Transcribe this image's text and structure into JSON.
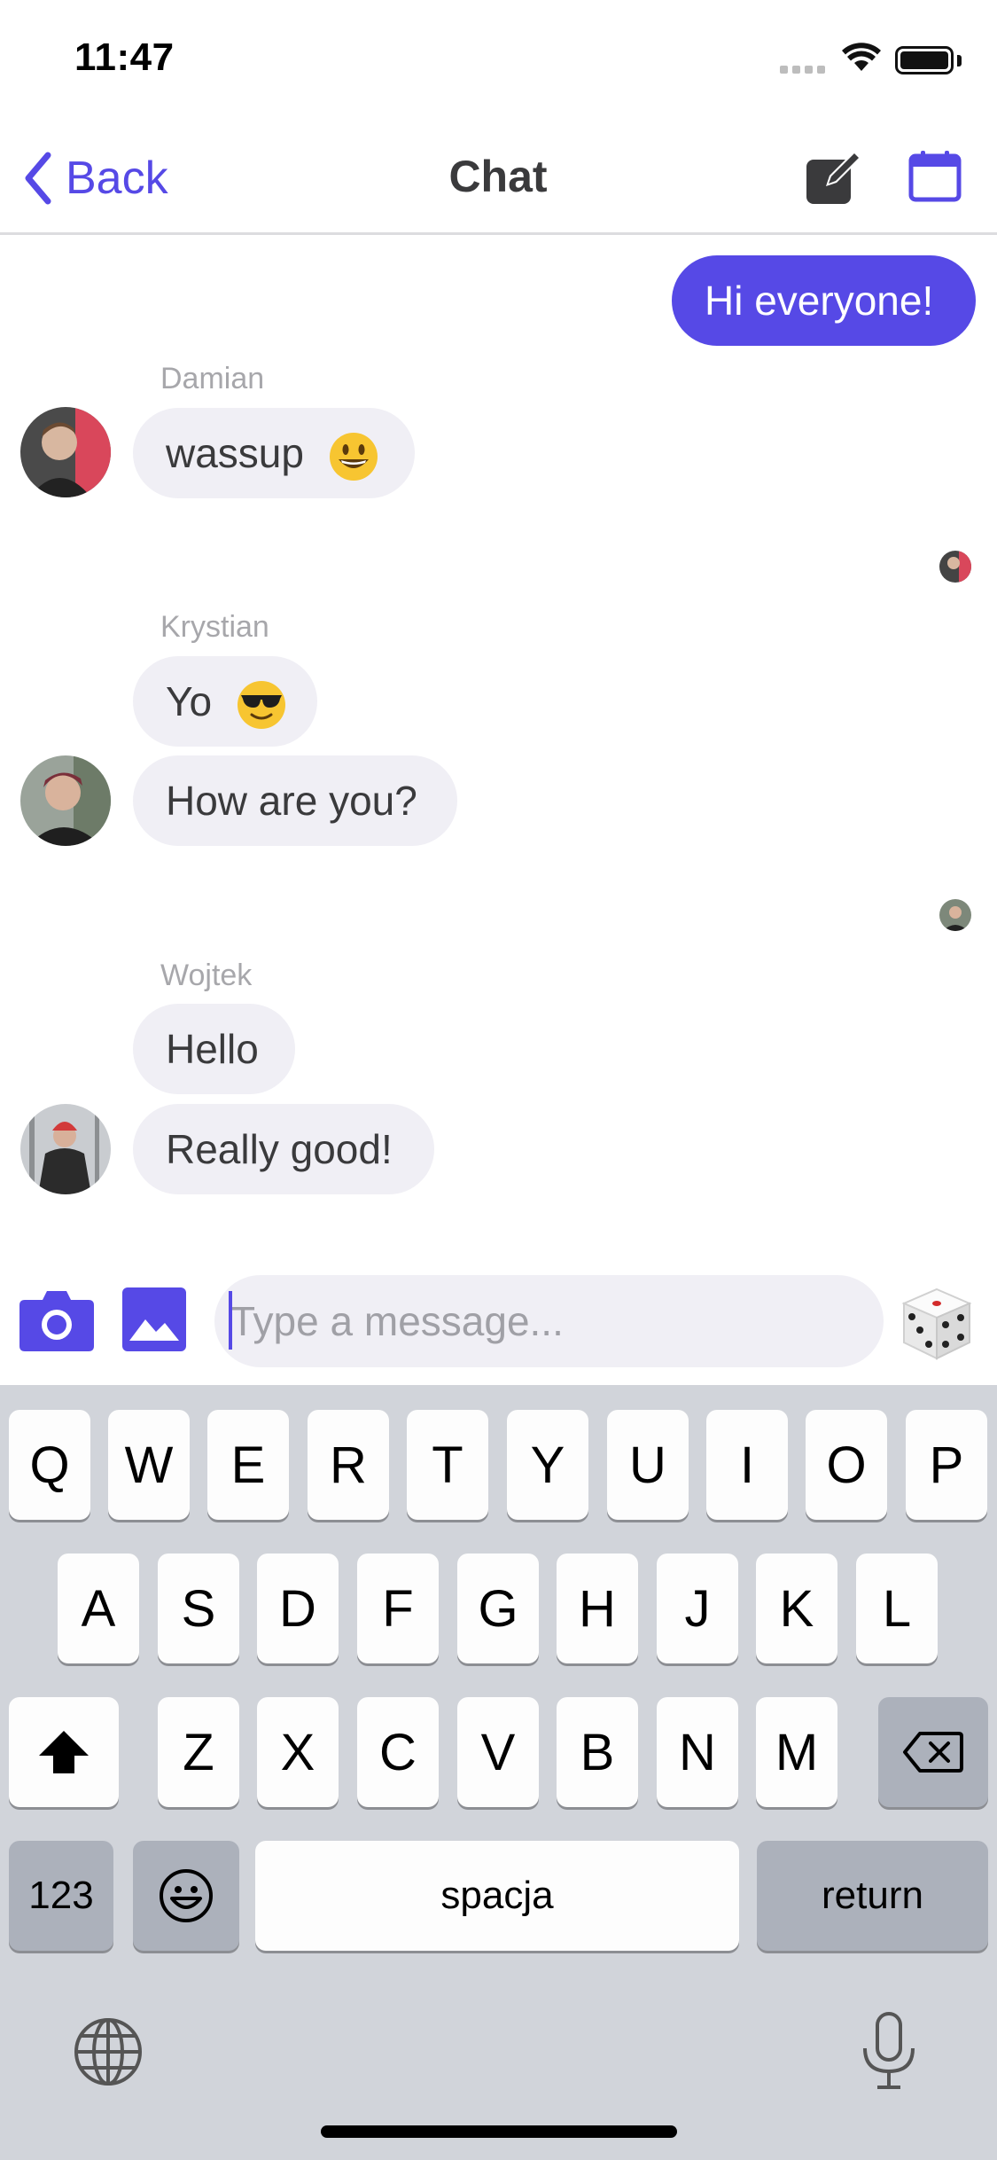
{
  "status": {
    "time": "11:47"
  },
  "nav": {
    "back_label": "Back",
    "title": "Chat"
  },
  "messages": {
    "outgoing": {
      "text": "Hi everyone!"
    },
    "damian": {
      "name": "Damian",
      "text": "wassup"
    },
    "krystian": {
      "name": "Krystian",
      "text1": "Yo",
      "text2": "How are you?"
    },
    "wojtek": {
      "name": "Wojtek",
      "text1": "Hello",
      "text2": "Really good!"
    }
  },
  "composer": {
    "placeholder": "Type a message...",
    "value": ""
  },
  "keyboard": {
    "row1": [
      "Q",
      "W",
      "E",
      "R",
      "T",
      "Y",
      "U",
      "I",
      "O",
      "P"
    ],
    "row2": [
      "A",
      "S",
      "D",
      "F",
      "G",
      "H",
      "J",
      "K",
      "L"
    ],
    "row3": [
      "Z",
      "X",
      "C",
      "V",
      "B",
      "N",
      "M"
    ],
    "numbers_label": "123",
    "space_label": "spacja",
    "return_label": "return"
  },
  "icons": {
    "back": "chevron-left-icon",
    "compose": "compose-icon",
    "calendar": "calendar-icon",
    "camera": "camera-icon",
    "gallery": "image-icon",
    "dice": "dice-icon",
    "shift": "shift-icon",
    "delete": "delete-icon",
    "emoji": "emoji-icon",
    "globe": "globe-icon",
    "mic": "microphone-icon"
  },
  "colors": {
    "accent": "#5649e6",
    "bubble_in": "#f0eff5",
    "keyboard_bg": "#d1d4da"
  }
}
